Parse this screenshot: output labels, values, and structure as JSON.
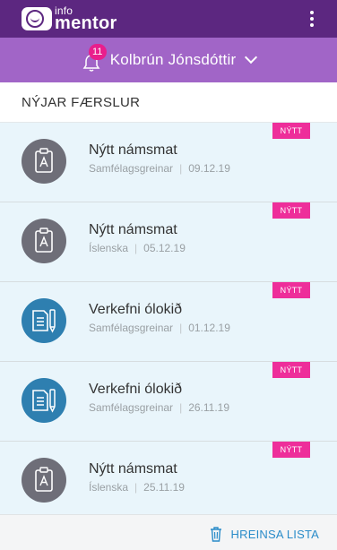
{
  "header": {
    "logo_small": "info",
    "logo_big": "mentor"
  },
  "user_bar": {
    "notification_count": "11",
    "user_name": "Kolbrún Jónsdóttir"
  },
  "section": {
    "title": "NÝJAR FÆRSLUR"
  },
  "items": [
    {
      "icon": "assessment-icon",
      "title": "Nýtt námsmat",
      "subject": "Samfélagsgreinar",
      "date": "09.12.19",
      "badge": "NÝTT"
    },
    {
      "icon": "assessment-icon",
      "title": "Nýtt námsmat",
      "subject": "Íslenska",
      "date": "05.12.19",
      "badge": "NÝTT"
    },
    {
      "icon": "assignment-icon",
      "title": "Verkefni ólokið",
      "subject": "Samfélagsgreinar",
      "date": "01.12.19",
      "badge": "NÝTT"
    },
    {
      "icon": "assignment-icon",
      "title": "Verkefni ólokið",
      "subject": "Samfélagsgreinar",
      "date": "26.11.19",
      "badge": "NÝTT"
    },
    {
      "icon": "assessment-icon",
      "title": "Nýtt námsmat",
      "subject": "Íslenska",
      "date": "25.11.19",
      "badge": "NÝTT"
    }
  ],
  "footer": {
    "clear_label": "HREINSA LISTA"
  },
  "colors": {
    "topbar": "#5c2780",
    "userbar": "#a165c7",
    "badge": "#ee2e9a",
    "item_bg": "#e9f5fb",
    "link": "#2a8cc9"
  }
}
